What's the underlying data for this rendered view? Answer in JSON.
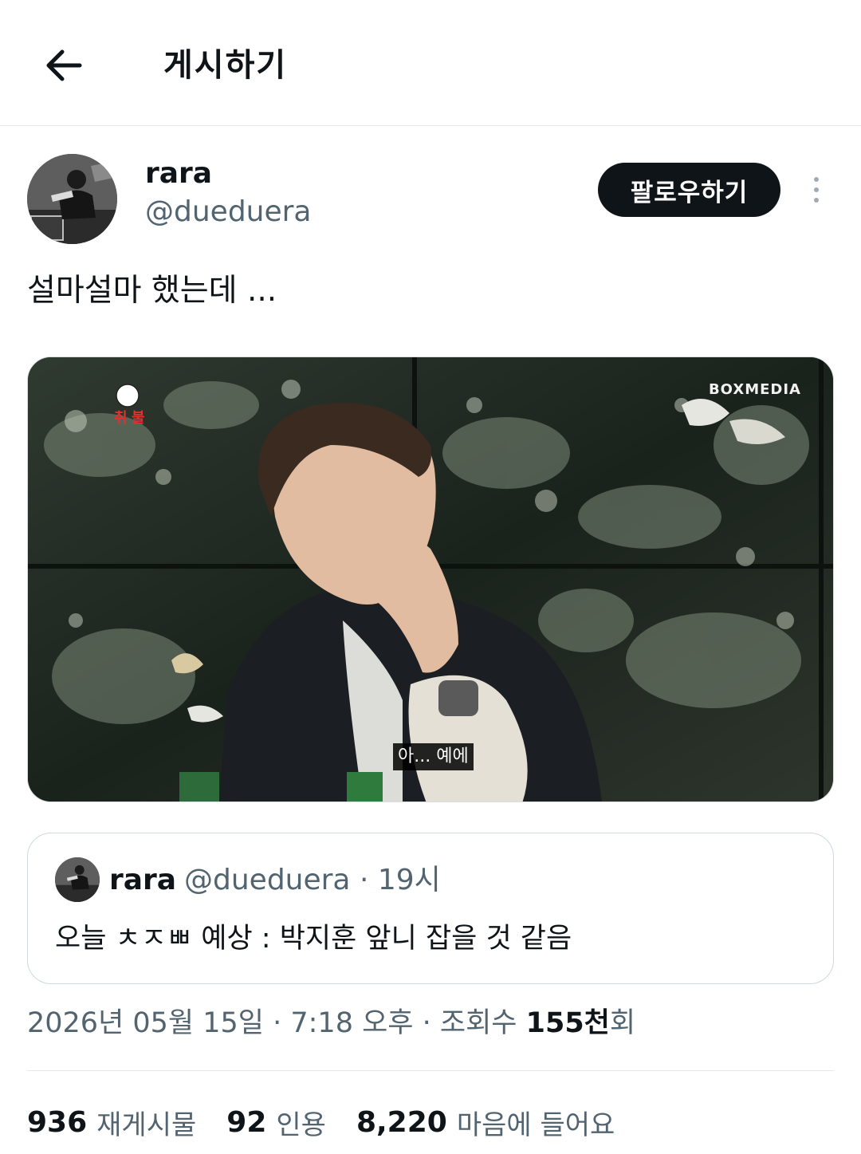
{
  "header": {
    "title": "게시하기"
  },
  "post": {
    "author": {
      "display_name": "rara",
      "handle": "@dueduera"
    },
    "follow_label": "팔로우하기",
    "text": "설마설마 했는데 ...",
    "media": {
      "watermark": "BOXMEDIA",
      "subtitle": "아... 예에"
    },
    "quote": {
      "display_name": "rara",
      "handle_time": "@dueduera · 19시",
      "text": "오늘 ㅊㅈㅃ 예상 : 박지훈 앞니 잡을 것 같음"
    },
    "meta": {
      "datetime": "2026년 05월 15일 · 7:18 오후 · 조회수 ",
      "views_number": "155천",
      "views_suffix": "회"
    },
    "stats": {
      "reposts_count": "936",
      "reposts_label": "재게시물",
      "quotes_count": "92",
      "quotes_label": "인용",
      "likes_count": "8,220",
      "likes_label": "마음에 들어요"
    }
  },
  "colors": {
    "text_primary": "#0f1419",
    "text_secondary": "#536471",
    "border": "#cfd9de",
    "button_bg": "#0f1419"
  },
  "icons": {
    "back": "arrow-left-icon",
    "more": "more-vertical-icon"
  }
}
